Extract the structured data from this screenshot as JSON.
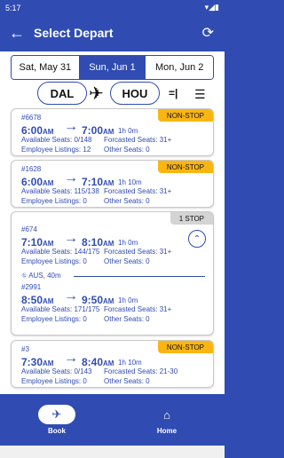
{
  "status_bar": {
    "time": "5:17",
    "icons": "▾◢▮"
  },
  "header": {
    "back_icon": "arrow-left-icon",
    "title": "Select Depart",
    "refresh_icon": "refresh-icon"
  },
  "date_tabs": [
    {
      "label": "Sat, May 31",
      "selected": false
    },
    {
      "label": "Sun, Jun 1",
      "selected": true
    },
    {
      "label": "Mon, Jun 2",
      "selected": false
    }
  ],
  "route": {
    "origin": "DAL",
    "destination": "HOU",
    "plane_icon": "airplane-icon",
    "swap_icon": "swap-icon",
    "filter_icon": "filter-icon"
  },
  "flights": [
    {
      "badge": "NON-STOP",
      "flight_number": "#6678",
      "depart_time": "6:00",
      "depart_ampm": "AM",
      "arrive_time": "7:00",
      "arrive_ampm": "AM",
      "duration": "1h 0m",
      "available_seats": "Available Seats: 0/148",
      "forecasted_seats": "Forcasted Seats: 31+",
      "employee_listings": "Employee Listings: 12",
      "other_seats": "Other Seats: 0"
    },
    {
      "badge": "NON-STOP",
      "flight_number": "#1628",
      "depart_time": "6:00",
      "depart_ampm": "AM",
      "arrive_time": "7:10",
      "arrive_ampm": "AM",
      "duration": "1h 10m",
      "available_seats": "Available Seats: 115/138",
      "forecasted_seats": "Forcasted Seats: 31+",
      "employee_listings": "Employee Listings: 0",
      "other_seats": "Other Seats: 0"
    },
    {
      "badge": "1 STOP",
      "legs": [
        {
          "flight_number": "#674",
          "depart_time": "7:10",
          "depart_ampm": "AM",
          "arrive_time": "8:10",
          "arrive_ampm": "AM",
          "duration": "1h 0m",
          "available_seats": "Available Seats: 144/175",
          "forecasted_seats": "Forcasted Seats: 31+",
          "employee_listings": "Employee Listings: 0",
          "other_seats": "Other Seats: 0"
        },
        {
          "flight_number": "#2991",
          "depart_time": "8:50",
          "depart_ampm": "AM",
          "arrive_time": "9:50",
          "arrive_ampm": "AM",
          "duration": "1h 0m",
          "available_seats": "Available Seats: 171/175",
          "forecasted_seats": "Forcasted Seats: 31+",
          "employee_listings": "Employee Listings: 0",
          "other_seats": "Other Seats: 0"
        }
      ],
      "layover": "AUS, 40m",
      "layover_icon": "connection-icon",
      "collapse_icon": "chevron-up-icon"
    },
    {
      "badge": "NON-STOP",
      "flight_number": "#3",
      "depart_time": "7:30",
      "depart_ampm": "AM",
      "arrive_time": "8:40",
      "arrive_ampm": "AM",
      "duration": "1h 10m",
      "available_seats": "Available Seats: 0/143",
      "forecasted_seats": "Forcasted Seats: 21-30",
      "employee_listings": "Employee Listings: 0",
      "other_seats": "Other Seats: 0"
    }
  ],
  "bottom_nav": [
    {
      "label": "Book",
      "icon": "airplane-icon",
      "active": true
    },
    {
      "label": "Home",
      "icon": "home-icon",
      "active": false
    }
  ],
  "colors": {
    "brand_blue": "#304CB2",
    "badge_yellow": "#F9B612",
    "badge_gray": "#d4d4d4"
  }
}
